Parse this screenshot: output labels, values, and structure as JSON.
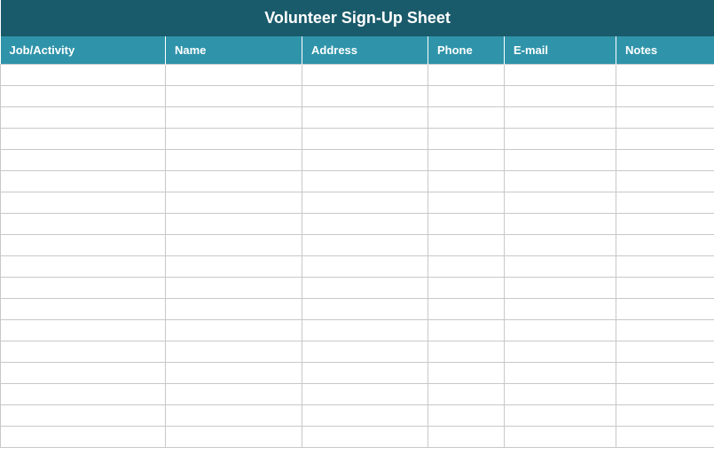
{
  "title": "Volunteer Sign-Up Sheet",
  "columns": [
    {
      "label": "Job/Activity"
    },
    {
      "label": "Name"
    },
    {
      "label": "Address"
    },
    {
      "label": "Phone"
    },
    {
      "label": "E-mail"
    },
    {
      "label": "Notes"
    }
  ],
  "rows": [
    {
      "job": "",
      "name": "",
      "address": "",
      "phone": "",
      "email": "",
      "notes": ""
    },
    {
      "job": "",
      "name": "",
      "address": "",
      "phone": "",
      "email": "",
      "notes": ""
    },
    {
      "job": "",
      "name": "",
      "address": "",
      "phone": "",
      "email": "",
      "notes": ""
    },
    {
      "job": "",
      "name": "",
      "address": "",
      "phone": "",
      "email": "",
      "notes": ""
    },
    {
      "job": "",
      "name": "",
      "address": "",
      "phone": "",
      "email": "",
      "notes": ""
    },
    {
      "job": "",
      "name": "",
      "address": "",
      "phone": "",
      "email": "",
      "notes": ""
    },
    {
      "job": "",
      "name": "",
      "address": "",
      "phone": "",
      "email": "",
      "notes": ""
    },
    {
      "job": "",
      "name": "",
      "address": "",
      "phone": "",
      "email": "",
      "notes": ""
    },
    {
      "job": "",
      "name": "",
      "address": "",
      "phone": "",
      "email": "",
      "notes": ""
    },
    {
      "job": "",
      "name": "",
      "address": "",
      "phone": "",
      "email": "",
      "notes": ""
    },
    {
      "job": "",
      "name": "",
      "address": "",
      "phone": "",
      "email": "",
      "notes": ""
    },
    {
      "job": "",
      "name": "",
      "address": "",
      "phone": "",
      "email": "",
      "notes": ""
    },
    {
      "job": "",
      "name": "",
      "address": "",
      "phone": "",
      "email": "",
      "notes": ""
    },
    {
      "job": "",
      "name": "",
      "address": "",
      "phone": "",
      "email": "",
      "notes": ""
    },
    {
      "job": "",
      "name": "",
      "address": "",
      "phone": "",
      "email": "",
      "notes": ""
    },
    {
      "job": "",
      "name": "",
      "address": "",
      "phone": "",
      "email": "",
      "notes": ""
    },
    {
      "job": "",
      "name": "",
      "address": "",
      "phone": "",
      "email": "",
      "notes": ""
    },
    {
      "job": "",
      "name": "",
      "address": "",
      "phone": "",
      "email": "",
      "notes": ""
    }
  ]
}
